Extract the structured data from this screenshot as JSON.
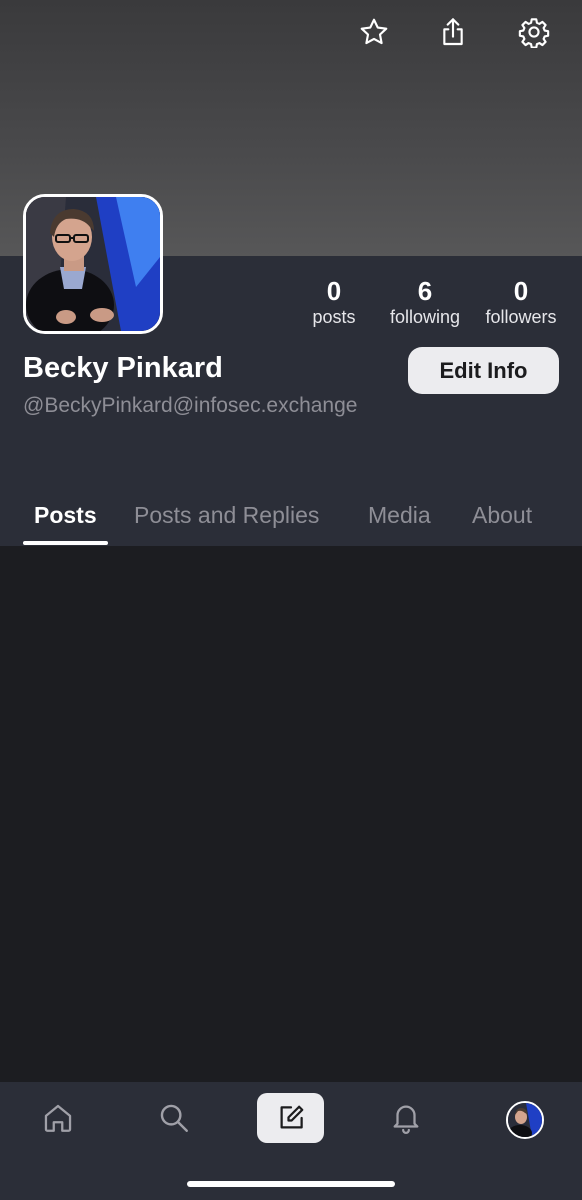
{
  "header": {
    "icons": [
      "star-icon",
      "share-icon",
      "gear-icon"
    ]
  },
  "profile": {
    "display_name": "Becky Pinkard",
    "handle": "@BeckyPinkard@infosec.exchange",
    "edit_label": "Edit Info",
    "stats": [
      {
        "value": "0",
        "label": "posts"
      },
      {
        "value": "6",
        "label": "following"
      },
      {
        "value": "0",
        "label": "followers"
      }
    ]
  },
  "tabs": [
    {
      "label": "Posts",
      "active": true
    },
    {
      "label": "Posts and Replies",
      "active": false
    },
    {
      "label": "Media",
      "active": false
    },
    {
      "label": "About",
      "active": false
    }
  ],
  "tabbar": {
    "icons": [
      "home-icon",
      "search-icon",
      "compose-icon",
      "bell-icon",
      "profile-avatar"
    ]
  },
  "colors": {
    "banner": "#4a4a4c",
    "panel": "#2b2e38",
    "background": "#1c1d21",
    "muted_text": "#8e8e96",
    "button_bg": "#ececef"
  }
}
